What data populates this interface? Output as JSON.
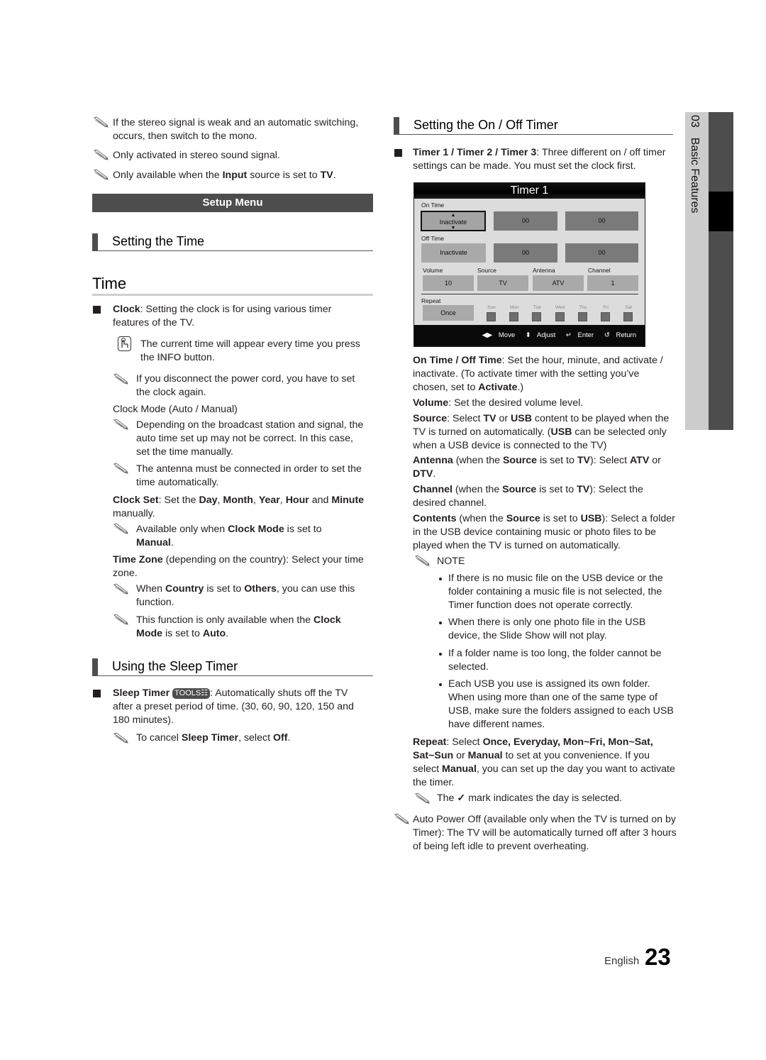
{
  "left_column": {
    "top_notes": [
      {
        "icon": "pencil-note-icon",
        "text": "If the stereo signal is weak and an automatic switching, occurs, then switch to the mono."
      },
      {
        "icon": "pencil-note-icon",
        "text": "Only activated in stereo sound signal."
      },
      {
        "icon": "pencil-note-icon",
        "parts": [
          "Only available when the ",
          "Input",
          " source is set to ",
          "TV",
          "."
        ]
      }
    ],
    "setup_menu_label": "Setup Menu",
    "setting_time_heading": "Setting the Time",
    "time_heading": "Time",
    "clock": {
      "label": "Clock",
      "text": ": Setting the clock is for using various timer features of the TV.",
      "info_note": {
        "icon": "remote-hand-icon",
        "text_a": "The current time will appear every time you press the ",
        "bold": "INFO",
        "text_b": " button."
      },
      "power_note": "If you disconnect the power cord, you have to set the clock again."
    },
    "clock_mode": {
      "label": "Clock Mode (Auto / Manual)",
      "notes": [
        "Depending on the broadcast station and signal, the auto time set up may not be correct. In this case, set the time manually.",
        "The antenna must be connected in order to set the time automatically."
      ]
    },
    "clock_set": {
      "label": "Clock Set",
      "parts": [
        ": Set the ",
        "Day",
        ", ",
        "Month",
        ", ",
        "Year",
        ", ",
        "Hour",
        " and ",
        "Minute",
        " manually."
      ],
      "note_a": "Available only when ",
      "note_bold": "Clock Mode",
      "note_b": " is set to ",
      "note_val": "Manual",
      "note_end": "."
    },
    "time_zone": {
      "label": "Time Zone",
      "text": " (depending on the country): Select your time zone.",
      "note1": [
        "When ",
        "Country",
        " is set to ",
        "Others",
        ", you can use this function."
      ],
      "note2": [
        "This function is only available when the ",
        "Clock Mode",
        " is set to ",
        "Auto",
        "."
      ]
    },
    "sleep_heading": "Using the Sleep Timer",
    "sleep_timer": {
      "label": "Sleep Timer",
      "tools_badge": "TOOLS",
      "text": ": Automatically shuts off the TV after a preset period of time. (30, 60, 90, 120, 150 and 180 minutes).",
      "note": [
        "To cancel ",
        "Sleep Timer",
        ", select ",
        "Off",
        "."
      ]
    }
  },
  "right_column": {
    "heading": "Setting the On / Off Timer",
    "timers_label": "Timer 1 / Timer 2 / Timer 3",
    "timers_text": ": Three different on / off timer settings can be made. You must set the clock first.",
    "osd": {
      "title": "Timer 1",
      "on_time_label": "On Time",
      "on_time_state": "Inactivate",
      "on_time_hour": "00",
      "on_time_minute": "00",
      "off_time_label": "Off Time",
      "off_time_state": "Inactivate",
      "off_time_hour": "00",
      "off_time_minute": "00",
      "volume_label": "Volume",
      "volume_value": "10",
      "source_label": "Source",
      "source_value": "TV",
      "antenna_label": "Antenna",
      "antenna_value": "ATV",
      "channel_label": "Channel",
      "channel_value": "1",
      "repeat_label": "Repeat",
      "repeat_value": "Once",
      "days": [
        "Sun",
        "Mon",
        "Tue",
        "Wed",
        "Thu",
        "Fri",
        "Sat"
      ],
      "footer": {
        "move": "Move",
        "adjust": "Adjust",
        "enter": "Enter",
        "return": "Return"
      }
    },
    "desc": {
      "on_off": [
        "On Time / Off Time",
        ": Set the hour, minute, and activate / inactivate. (To activate timer with the setting you’ve chosen, set to ",
        "Activate",
        ".)"
      ],
      "volume": [
        "Volume",
        ": Set the desired volume level."
      ],
      "source": [
        "Source",
        ": Select ",
        "TV",
        " or ",
        "USB",
        " content to be played when the TV is turned on automatically. (",
        "USB",
        " can be selected only when a USB device is connected to the TV)"
      ],
      "antenna": [
        "Antenna",
        " (when the ",
        "Source",
        " is set to ",
        "TV",
        "): Select ",
        "ATV",
        " or ",
        "DTV",
        "."
      ],
      "channel": [
        "Channel",
        " (when the ",
        "Source",
        " is set to ",
        "TV",
        "): Select the desired channel."
      ],
      "contents": [
        "Contents",
        " (when the ",
        "Source",
        " is set to ",
        "USB",
        "): Select a folder in the USB device containing music or photo files to be played when the TV is turned on automatically."
      ]
    },
    "note_label": "NOTE",
    "note_bullets": [
      "If there is no music file on the USB device or the folder containing a music file is not selected, the Timer function does not operate correctly.",
      "When there is only one photo file in the USB device, the Slide Show will not play.",
      "If a folder name is too long, the folder cannot be selected.",
      "Each USB you use is assigned its own folder. When using more than one of the same type of USB, make sure the folders assigned to each USB have different names."
    ],
    "repeat": [
      "Repeat",
      ": Select ",
      "Once, Everyday, Mon~Fri, Mon~Sat, Sat~Sun",
      " or ",
      "Manual",
      " to set at you convenience. If you select ",
      "Manual",
      ", you can set up the day you want to activate the timer."
    ],
    "check_note": [
      "The ",
      " mark indicates the day is selected."
    ],
    "auto_power_off": "Auto Power Off (available only when the TV is turned on by Timer): The TV will be automatically turned off after 3 hours of being left idle to prevent overheating."
  },
  "side_tab": {
    "chapter": "03",
    "title": "Basic Features"
  },
  "footer": {
    "language": "English",
    "page_number": "23"
  }
}
